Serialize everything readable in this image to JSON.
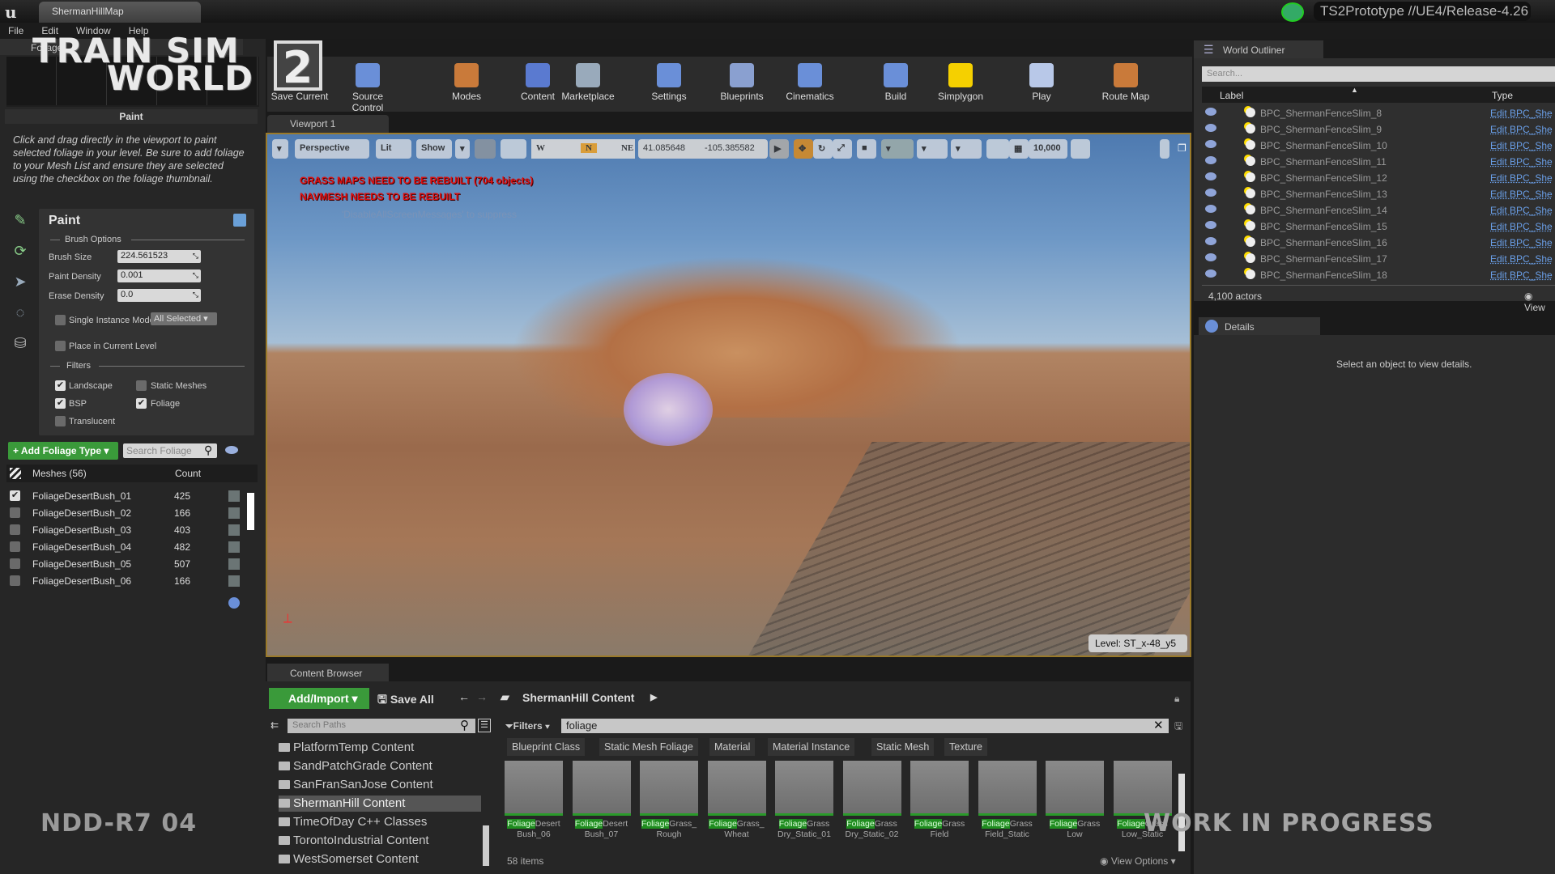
{
  "window": {
    "tab_title": "ShermanHillMap",
    "project": "TS2Prototype //UE4/Release-4.26"
  },
  "menu": [
    "File",
    "Edit",
    "Window",
    "Help"
  ],
  "logo": {
    "line1": "TRAIN SIM",
    "line2": "WORLD",
    "number": "2"
  },
  "left_panel": {
    "tab_label": "Foliage",
    "section_title": "Paint",
    "help_text": "Click and drag directly in the viewport to paint selected foliage in your level. Be sure to add foliage to your Mesh List and ensure they are selected using the checkbox on the foliage thumbnail.",
    "paint_title": "Paint",
    "brush_options_label": "Brush Options",
    "brush_size_label": "Brush Size",
    "brush_size": "224.561523",
    "paint_density_label": "Paint Density",
    "paint_density": "0.001",
    "erase_density_label": "Erase Density",
    "erase_density": "0.0",
    "single_instance_label": "Single Instance Mode",
    "single_instance_option": "All Selected",
    "place_current_level_label": "Place in Current Level",
    "filters_label": "Filters",
    "filters": {
      "landscape": "Landscape",
      "static_meshes": "Static Meshes",
      "bsp": "BSP",
      "foliage": "Foliage",
      "translucent": "Translucent"
    },
    "add_foliage_label": "Add Foliage Type",
    "search_placeholder": "Search Foliage",
    "meshes_header": "Meshes (56)",
    "count_header": "Count",
    "meshes": [
      {
        "name": "FoliageDesertBush_01",
        "count": "425",
        "checked": true
      },
      {
        "name": "FoliageDesertBush_02",
        "count": "166",
        "checked": false
      },
      {
        "name": "FoliageDesertBush_03",
        "count": "403",
        "checked": false
      },
      {
        "name": "FoliageDesertBush_04",
        "count": "482",
        "checked": false
      },
      {
        "name": "FoliageDesertBush_05",
        "count": "507",
        "checked": false
      },
      {
        "name": "FoliageDesertBush_06",
        "count": "166",
        "checked": false
      }
    ]
  },
  "toolbar": {
    "save_current": "Save Current",
    "source_control": "Source Control",
    "modes": "Modes",
    "content": "Content",
    "marketplace": "Marketplace",
    "settings": "Settings",
    "blueprints": "Blueprints",
    "cinematics": "Cinematics",
    "build": "Build",
    "simplygon": "Simplygon",
    "play": "Play",
    "route_map": "Route Map"
  },
  "viewport": {
    "tab_label": "Viewport 1",
    "perspective": "Perspective",
    "lit": "Lit",
    "show": "Show",
    "compass": {
      "w": "W",
      "n": "N",
      "ne": "NE"
    },
    "lat": "41.085648",
    "lon": "-105.385582",
    "grid_value": "10,000",
    "warning1": "GRASS MAPS NEED TO BE REBUILT (704 objects)",
    "warning2": "NAVMESH NEEDS TO BE REBUILT",
    "hint": "'DisableAllScreenMessages' to suppress",
    "level": "Level:  ST_x-48_y5"
  },
  "outliner": {
    "tab_label": "World Outliner",
    "search_placeholder": "Search...",
    "col_label": "Label",
    "col_type": "Type",
    "rows": [
      {
        "label": "BPC_ShermanFenceSlim_8",
        "type": "Edit BPC_She"
      },
      {
        "label": "BPC_ShermanFenceSlim_9",
        "type": "Edit BPC_She"
      },
      {
        "label": "BPC_ShermanFenceSlim_10",
        "type": "Edit BPC_She"
      },
      {
        "label": "BPC_ShermanFenceSlim_11",
        "type": "Edit BPC_She"
      },
      {
        "label": "BPC_ShermanFenceSlim_12",
        "type": "Edit BPC_She"
      },
      {
        "label": "BPC_ShermanFenceSlim_13",
        "type": "Edit BPC_She"
      },
      {
        "label": "BPC_ShermanFenceSlim_14",
        "type": "Edit BPC_She"
      },
      {
        "label": "BPC_ShermanFenceSlim_15",
        "type": "Edit BPC_She"
      },
      {
        "label": "BPC_ShermanFenceSlim_16",
        "type": "Edit BPC_She"
      },
      {
        "label": "BPC_ShermanFenceSlim_17",
        "type": "Edit BPC_She"
      },
      {
        "label": "BPC_ShermanFenceSlim_18",
        "type": "Edit BPC_She"
      }
    ],
    "actor_count": "4,100 actors",
    "view_options": "View"
  },
  "details": {
    "tab_label": "Details",
    "empty_text": "Select an object to view details."
  },
  "content_browser": {
    "tab_label": "Content Browser",
    "add_import": "Add/Import",
    "save_all": "Save All",
    "current_path": "ShermanHill Content",
    "search_paths_placeholder": "Search Paths",
    "filters_label": "Filters",
    "filter_value": "foliage",
    "paths": [
      "PlatformTemp Content",
      "SandPatchGrade Content",
      "SanFranSanJose Content",
      "ShermanHill Content",
      "TimeOfDay C++ Classes",
      "TorontoIndustrial Content",
      "WestSomerset Content"
    ],
    "selected_path": "ShermanHill Content",
    "chips": [
      "Blueprint Class",
      "Static Mesh Foliage",
      "Material",
      "Material Instance",
      "Static Mesh",
      "Texture"
    ],
    "assets": [
      {
        "hl": "Foliage",
        "rest1": "Desert",
        "rest2": "Bush_06"
      },
      {
        "hl": "Foliage",
        "rest1": "Desert",
        "rest2": "Bush_07"
      },
      {
        "hl": "Foliage",
        "rest1": "Grass_",
        "rest2": "Rough"
      },
      {
        "hl": "Foliage",
        "rest1": "Grass_",
        "rest2": "Wheat"
      },
      {
        "hl": "Foliage",
        "rest1": "Grass",
        "rest2": "Dry_Static_01"
      },
      {
        "hl": "Foliage",
        "rest1": "Grass",
        "rest2": "Dry_Static_02"
      },
      {
        "hl": "Foliage",
        "rest1": "Grass",
        "rest2": "Field"
      },
      {
        "hl": "Foliage",
        "rest1": "Grass",
        "rest2": "Field_Static"
      },
      {
        "hl": "Foliage",
        "rest1": "Grass",
        "rest2": "Low"
      },
      {
        "hl": "Foliage",
        "rest1": "Grass",
        "rest2": "Low_Static"
      }
    ],
    "item_count": "58 items",
    "view_options": "View Options"
  },
  "overlays": {
    "build_id": "NDD-R7 04",
    "wip": "WORK IN PROGRESS"
  }
}
